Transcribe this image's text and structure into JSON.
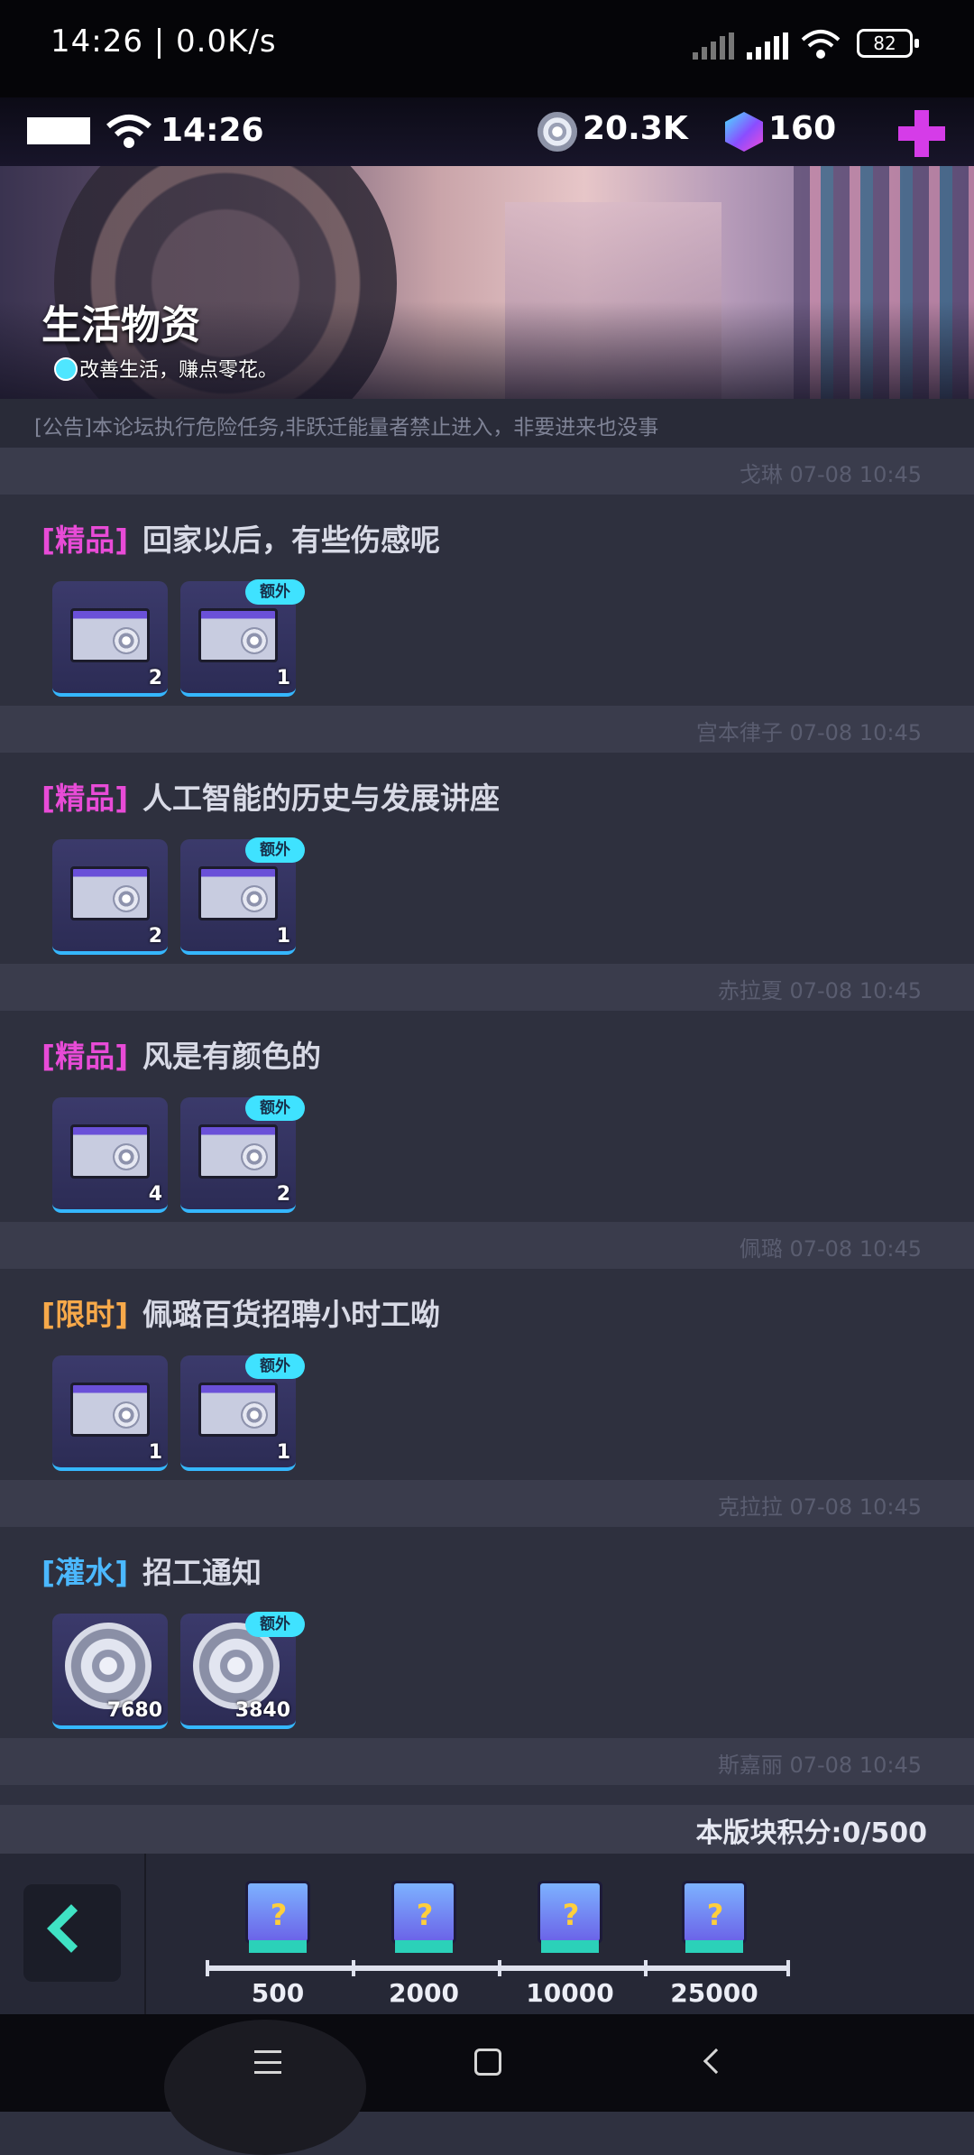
{
  "status_bar": {
    "time": "14:26 | 0.0K/s",
    "battery": "82"
  },
  "game_bar": {
    "clock": "14:26",
    "coins": "20.3K",
    "gems": "160"
  },
  "banner": {
    "title": "生活物资",
    "subtitle": "改善生活，赚点零花。"
  },
  "notice": "[公告]本论坛执行危险任务,非跃迁能量者禁止进入，非要进来也没事",
  "posts": [
    {
      "meta": "戈琳  07-08 10:45",
      "tag": "[精品]",
      "tag_color": "#e84bd7",
      "title": "回家以后，有些伤感呢",
      "items": [
        {
          "qty": "2"
        },
        {
          "qty": "1",
          "badge": "额外"
        }
      ]
    },
    {
      "meta": "宫本律子  07-08 10:45",
      "tag": "[精品]",
      "tag_color": "#e84bd7",
      "title": "人工智能的历史与发展讲座",
      "items": [
        {
          "qty": "2"
        },
        {
          "qty": "1",
          "badge": "额外"
        }
      ]
    },
    {
      "meta": "赤拉夏  07-08 10:45",
      "tag": "[精品]",
      "tag_color": "#e84bd7",
      "title": "风是有颜色的",
      "items": [
        {
          "qty": "4"
        },
        {
          "qty": "2",
          "badge": "额外"
        }
      ]
    },
    {
      "meta": "佩璐  07-08 10:45",
      "tag": "[限时]",
      "tag_color": "#f7a94a",
      "title": "佩璐百货招聘小时工呦",
      "items": [
        {
          "qty": "1"
        },
        {
          "qty": "1",
          "badge": "额外"
        }
      ]
    },
    {
      "meta": "克拉拉  07-08 10:45",
      "tag": "[灌水]",
      "tag_color": "#4bb8ff",
      "title": "招工通知",
      "items": [
        {
          "qty": "7680"
        },
        {
          "qty": "3840",
          "badge": "额外"
        }
      ]
    }
  ],
  "last_meta": "斯嘉丽  07-08 10:45",
  "points_label": "本版块积分:0/500",
  "milestones": [
    "500",
    "2000",
    "10000",
    "25000"
  ]
}
